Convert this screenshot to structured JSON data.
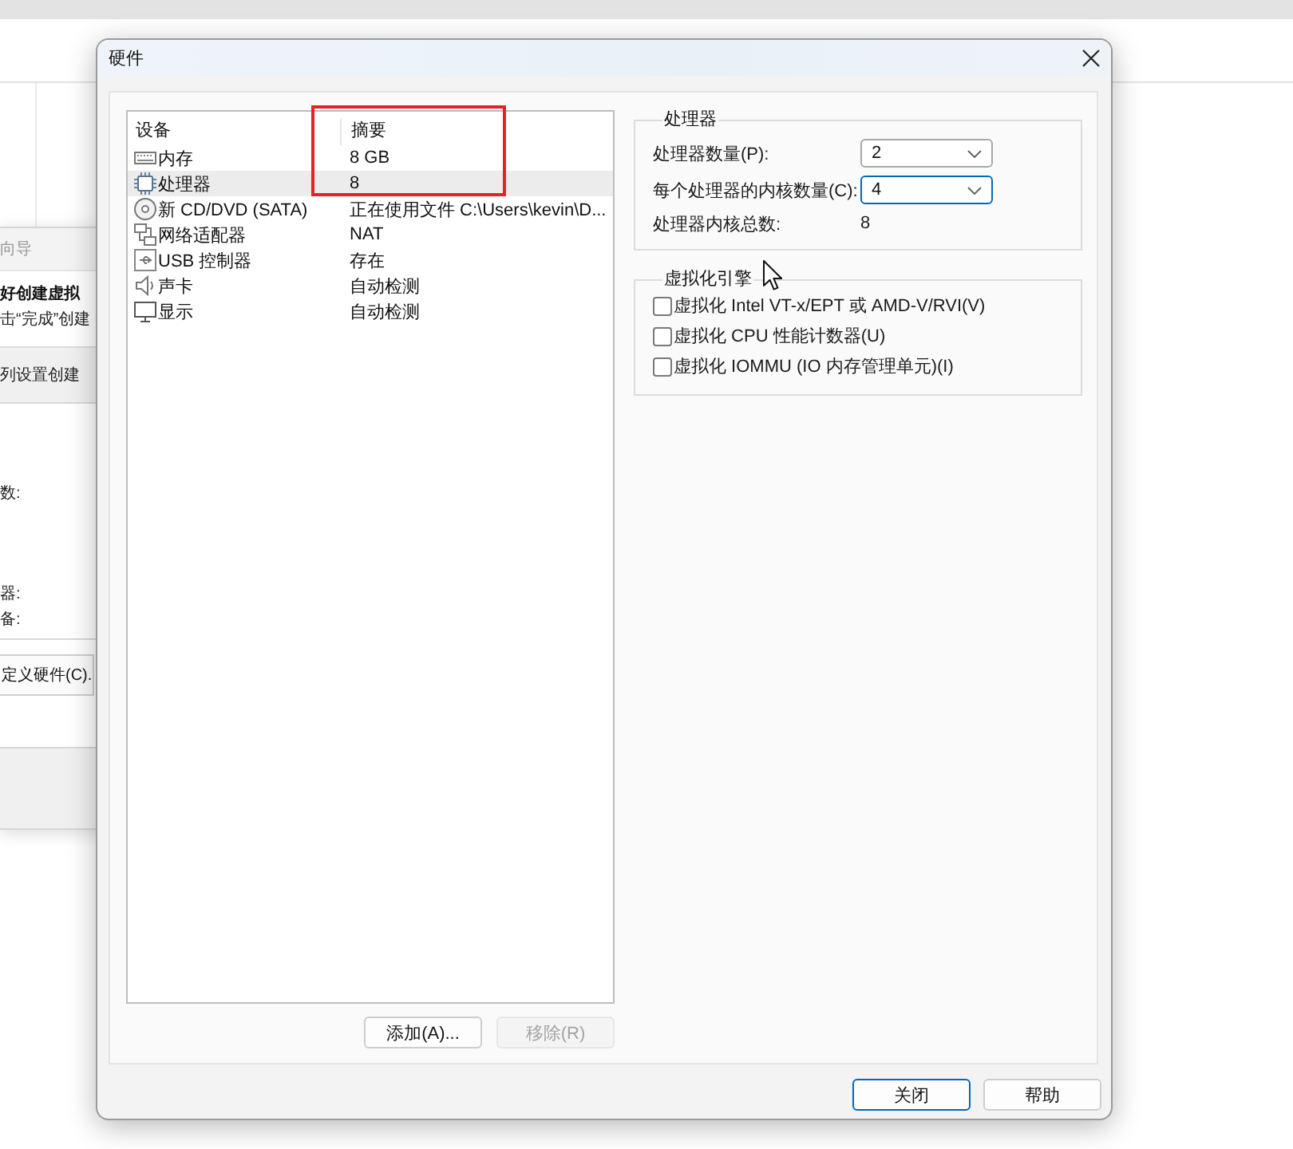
{
  "background_window": {
    "title": "向导",
    "heading": "好创建虚拟",
    "note": "击“完成”创建",
    "section_title": "列设置创建",
    "fields": [
      "数:",
      "器:",
      "备:"
    ],
    "button": "定义硬件(C)."
  },
  "window": {
    "title": "硬件"
  },
  "devices": {
    "columns": [
      "设备",
      "摘要"
    ],
    "annotation_frame": true,
    "rows": [
      {
        "kind": "memory",
        "name": "内存",
        "summary": "8 GB",
        "selected": false
      },
      {
        "kind": "processor",
        "name": "处理器",
        "summary": "8",
        "selected": true
      },
      {
        "kind": "cd",
        "name": "新 CD/DVD (SATA)",
        "summary": "正在使用文件 C:\\Users\\kevin\\D...",
        "selected": false
      },
      {
        "kind": "network",
        "name": "网络适配器",
        "summary": "NAT",
        "selected": false
      },
      {
        "kind": "usb",
        "name": "USB 控制器",
        "summary": "存在",
        "selected": false
      },
      {
        "kind": "sound",
        "name": "声卡",
        "summary": "自动检测",
        "selected": false
      },
      {
        "kind": "display",
        "name": "显示",
        "summary": "自动检测",
        "selected": false
      }
    ]
  },
  "list_buttons": [
    {
      "label": "添加(A)...",
      "disabled": false
    },
    {
      "label": "移除(R)",
      "disabled": true
    }
  ],
  "processor_group": {
    "title": "处理器",
    "fields": [
      {
        "kind": "dropdown",
        "label": "处理器数量(P):",
        "value": "2",
        "focused": false
      },
      {
        "kind": "dropdown",
        "label": "每个处理器的内核数量(C):",
        "value": "4",
        "focused": true
      },
      {
        "kind": "readout",
        "label": "处理器内核总数:",
        "value": "8"
      }
    ]
  },
  "virtualization_group": {
    "title": "虚拟化引擎",
    "options": [
      {
        "label": "虚拟化 Intel VT-x/EPT 或 AMD-V/RVI(V)",
        "checked": false
      },
      {
        "label": "虚拟化 CPU 性能计数器(U)",
        "checked": false
      },
      {
        "label": "虚拟化 IOMMU (IO 内存管理单元)(I)",
        "checked": false
      }
    ]
  },
  "buttons": [
    {
      "label": "关闭",
      "default": true
    },
    {
      "label": "帮助",
      "default": false
    }
  ]
}
